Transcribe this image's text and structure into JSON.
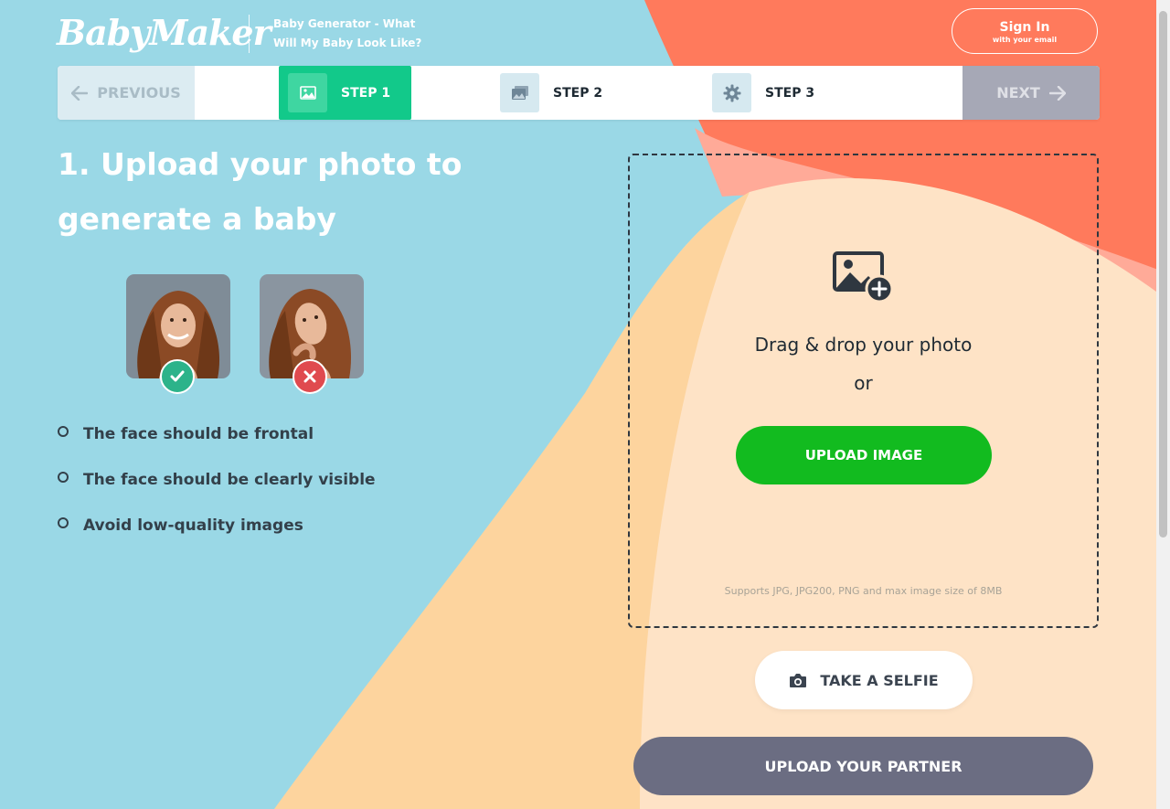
{
  "header": {
    "logo_text": "BabyMaker",
    "tagline": "Baby Generator - What Will My Baby Look Like?",
    "signin_label": "Sign In",
    "signin_sub": "with your email"
  },
  "steps": {
    "previous_label": "PREVIOUS",
    "next_label": "NEXT",
    "items": [
      {
        "label": "STEP 1",
        "icon": "image-icon",
        "active": true
      },
      {
        "label": "STEP 2",
        "icon": "images-icon",
        "active": false
      },
      {
        "label": "STEP 3",
        "icon": "gear-icon",
        "active": false
      }
    ]
  },
  "instructions": {
    "heading": "1. Upload your photo to generate a baby",
    "examples": [
      {
        "status": "good",
        "icon": "checkmark-icon"
      },
      {
        "status": "bad",
        "icon": "cross-icon"
      }
    ],
    "rules": [
      "The face should be frontal",
      "The face should be clearly visible",
      "Avoid low-quality images"
    ]
  },
  "dropzone": {
    "icon": "add-image-icon",
    "drag_text": "Drag & drop your photo",
    "or_text": "or",
    "upload_label": "UPLOAD IMAGE",
    "supports_text": "Supports JPG, JPG200, PNG and max image size of 8MB"
  },
  "actions": {
    "selfie_label": "TAKE A SELFIE",
    "partner_label": "UPLOAD YOUR PARTNER"
  },
  "colors": {
    "background_blue": "#9ad8e6",
    "coral": "#ff7a5c",
    "peach": "#fdd49e",
    "step_active": "#12c98a",
    "upload_green": "#12bb1f",
    "partner_gray": "#6b6d82"
  }
}
